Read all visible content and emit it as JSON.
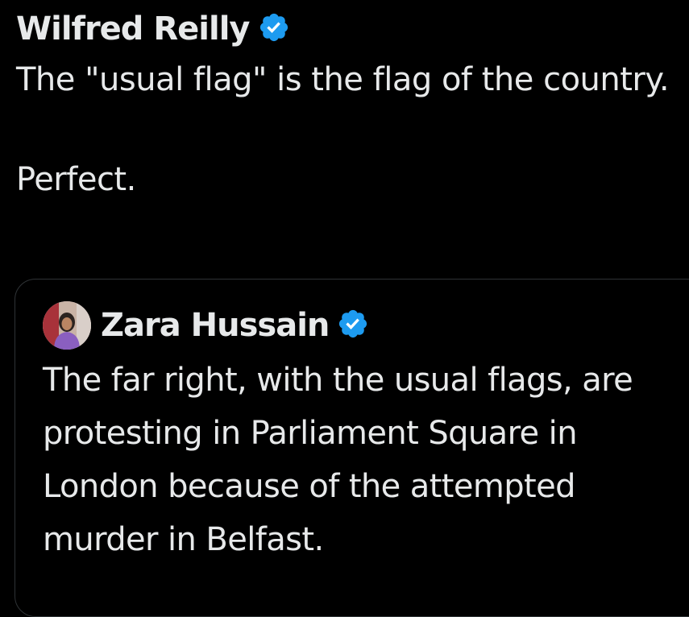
{
  "tweet": {
    "author_name": "Wilfred Reilly",
    "verified_icon": "verified-badge-icon",
    "text": "The \"usual flag\" is the flag of the country.\n\nPerfect."
  },
  "quote": {
    "author_name": "Zara Hussain",
    "verified_icon": "verified-badge-icon",
    "avatar_icon": "avatar",
    "text": "The far right, with the usual flags, are protesting in Parliament Square in London because of the attempted murder in Belfast."
  },
  "colors": {
    "background": "#000000",
    "text": "#e7e9ea",
    "verified_blue": "#1d9bf0",
    "card_border": "#2f3336"
  }
}
